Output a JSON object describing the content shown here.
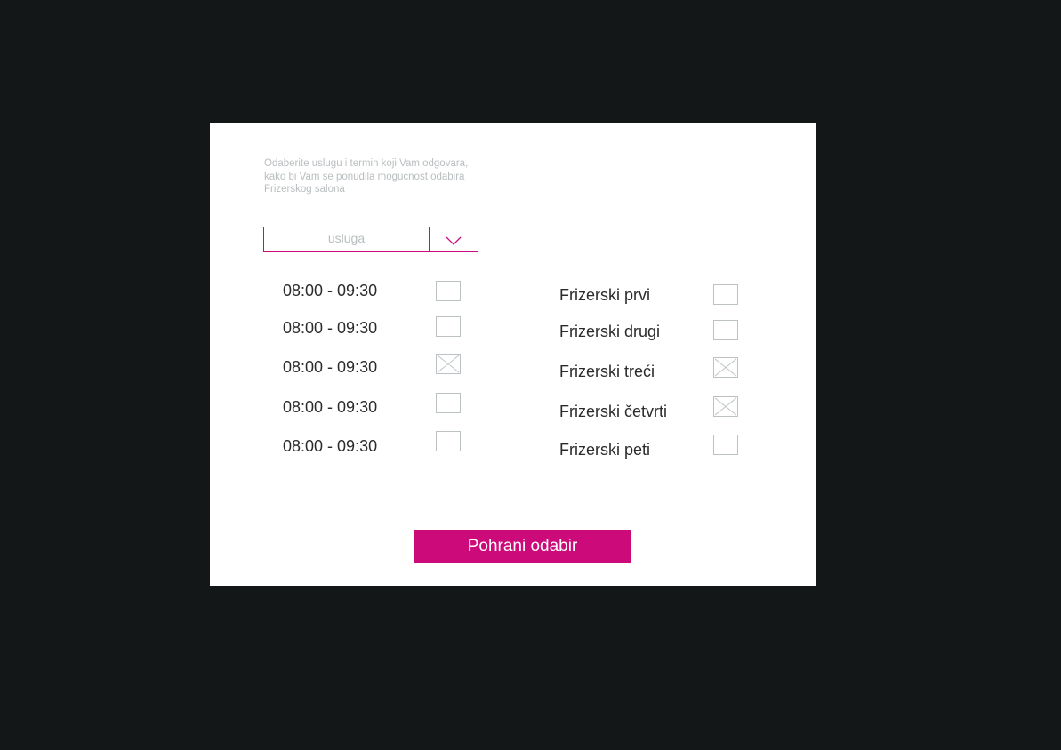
{
  "instructions": [
    "Odaberite uslugu i termin koji Vam odgovara,",
    "kako bi Vam se ponudila mogućnost odabira",
    "Frizerskog salona"
  ],
  "service_select": {
    "value": "usluga",
    "arrow_icon": "chevron-down-icon"
  },
  "time_slots": [
    {
      "label": "08:00 - 09:30",
      "checked": false
    },
    {
      "label": "08:00 - 09:30",
      "checked": false
    },
    {
      "label": "08:00 - 09:30",
      "checked": true
    },
    {
      "label": "08:00 - 09:30",
      "checked": false
    },
    {
      "label": "08:00 - 09:30",
      "checked": false
    }
  ],
  "salons": [
    {
      "label": "Frizerski prvi",
      "checked": false
    },
    {
      "label": "Frizerski drugi",
      "checked": false
    },
    {
      "label": "Frizerski treći",
      "checked": true
    },
    {
      "label": "Frizerski četvrti",
      "checked": true
    },
    {
      "label": "Frizerski peti",
      "checked": false
    }
  ],
  "save_button": {
    "label": "Pohrani odabir"
  },
  "colors": {
    "background": "#141718",
    "panel": "#ffffff",
    "accent": "#cc0a7a",
    "muted_text": "#b9bec0",
    "text": "#2b2b2b",
    "checkbox_border": "#bcc2c4"
  }
}
